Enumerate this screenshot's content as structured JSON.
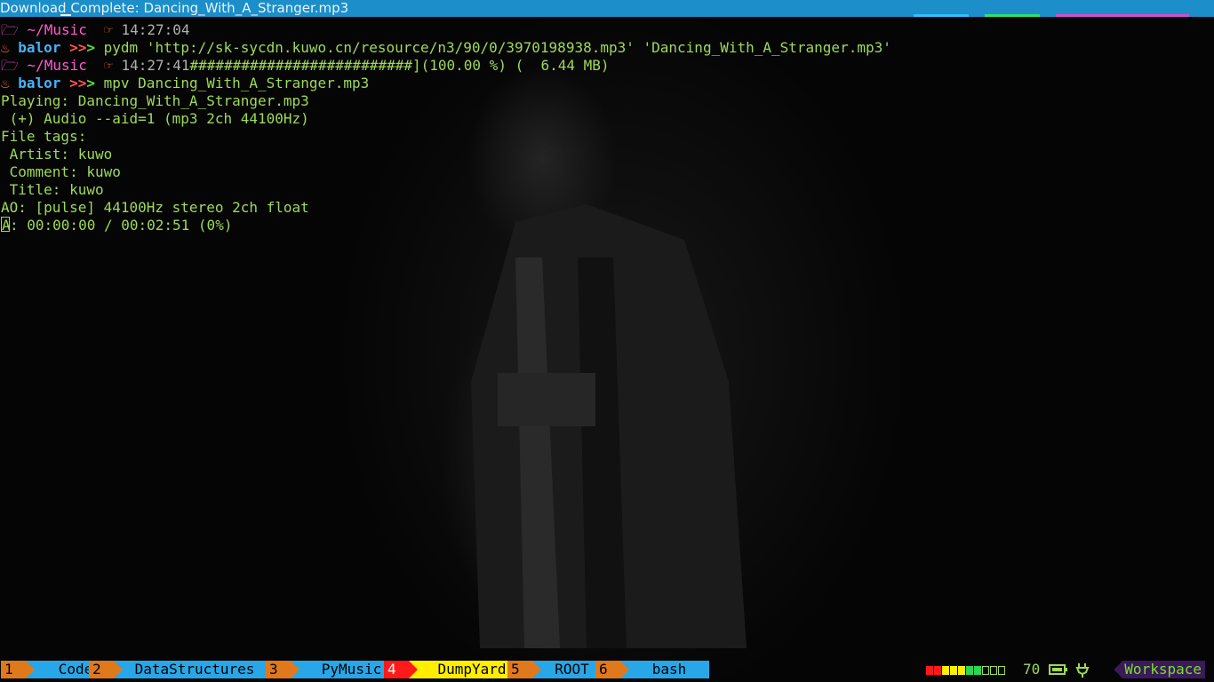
{
  "window": {
    "title": "Download Complete: Dancing_With_A_Stranger.mp3"
  },
  "terminal": {
    "prompt1": {
      "folder_icon": "folder-icon",
      "path": "~/Music",
      "hand_icon": "pointing-hand-icon",
      "time": "14:27:04"
    },
    "cmd1": {
      "flame_icon": "flame-icon",
      "user": "balor",
      "arrows": ">>",
      "arrow_last": ">",
      "command": "pydm 'http://sk-sycdn.kuwo.cn/resource/n3/90/0/3970198938.mp3' 'Dancing_With_A_Stranger.mp3'"
    },
    "prompt2": {
      "path": "~/Music",
      "time": "14:27:41",
      "progress": "##########################](100.00 %) (  6.44 MB)"
    },
    "cmd2": {
      "user": "balor",
      "arrows": ">>",
      "arrow_last": ">",
      "command": "mpv Dancing_With_A_Stranger.mp3"
    },
    "output": [
      "Playing: Dancing_With_A_Stranger.mp3",
      " (+) Audio --aid=1 (mp3 2ch 44100Hz)",
      "File tags:",
      " Artist: kuwo",
      " Comment: kuwo",
      " Title: kuwo",
      "AO: [pulse] 44100Hz stereo 2ch float"
    ],
    "status_cursor": "A",
    "status_rest": ": 00:00:00 / 00:02:51 (0%)"
  },
  "statusbar": {
    "workspaces": [
      {
        "num": "1",
        "name": "Code",
        "num_color": "#e0791c",
        "name_color": "#27a7e8",
        "active": false
      },
      {
        "num": "2",
        "name": "DataStructures",
        "num_color": "#e0791c",
        "name_color": "#27a7e8",
        "active": false
      },
      {
        "num": "3",
        "name": "PyMusic",
        "num_color": "#e0791c",
        "name_color": "#27a7e8",
        "active": false
      },
      {
        "num": "4",
        "name": "DumpYard",
        "num_color": "#ff1a1a",
        "name_color": "#ffee00",
        "active": true
      },
      {
        "num": "5",
        "name": "ROOT",
        "num_color": "#e0791c",
        "name_color": "#27a7e8",
        "active": false
      },
      {
        "num": "6",
        "name": "bash",
        "num_color": "#e0791c",
        "name_color": "#27a7e8",
        "active": false
      }
    ],
    "volume": "70",
    "volume_meter": [
      "#ff1a1a",
      "#ff1a1a",
      "#ffee00",
      "#ffee00",
      "#ffee00",
      "#28d84f",
      "#28d84f",
      "empty",
      "empty",
      "empty"
    ],
    "battery_icon": "battery-icon",
    "plug_icon": "plug-icon",
    "workspace_label": "Workspace"
  }
}
